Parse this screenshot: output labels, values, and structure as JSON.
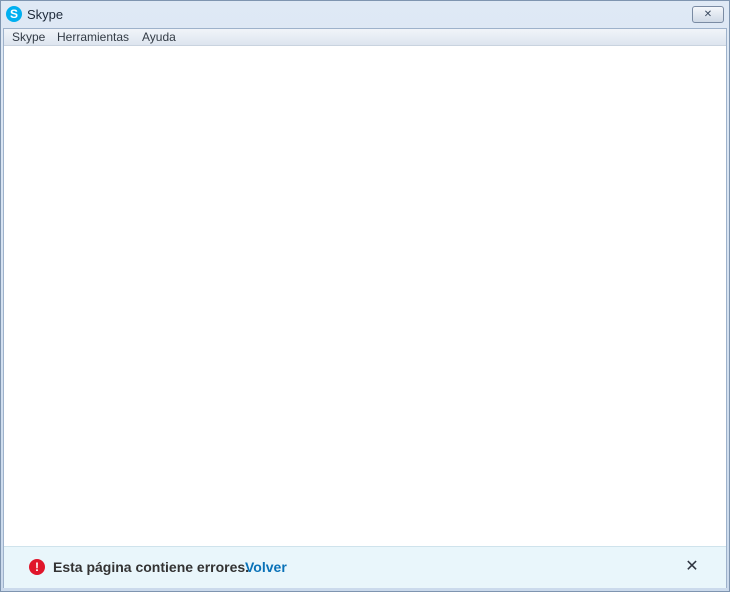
{
  "window": {
    "title": "Skype",
    "logo_glyph": "S",
    "close_glyph": "✕",
    "icon": "skype-logo-icon"
  },
  "menu": {
    "items": [
      {
        "label": "Skype"
      },
      {
        "label": "Herramientas"
      },
      {
        "label": "Ayuda"
      }
    ]
  },
  "error_bar": {
    "icon": "error-icon",
    "icon_glyph": "!",
    "message": "Esta página contiene errores.",
    "link": "Volver",
    "dismiss_glyph": "✕",
    "colors": {
      "background": "#e9f6fb",
      "icon": "#e0162b",
      "link": "#0a72b8"
    }
  }
}
